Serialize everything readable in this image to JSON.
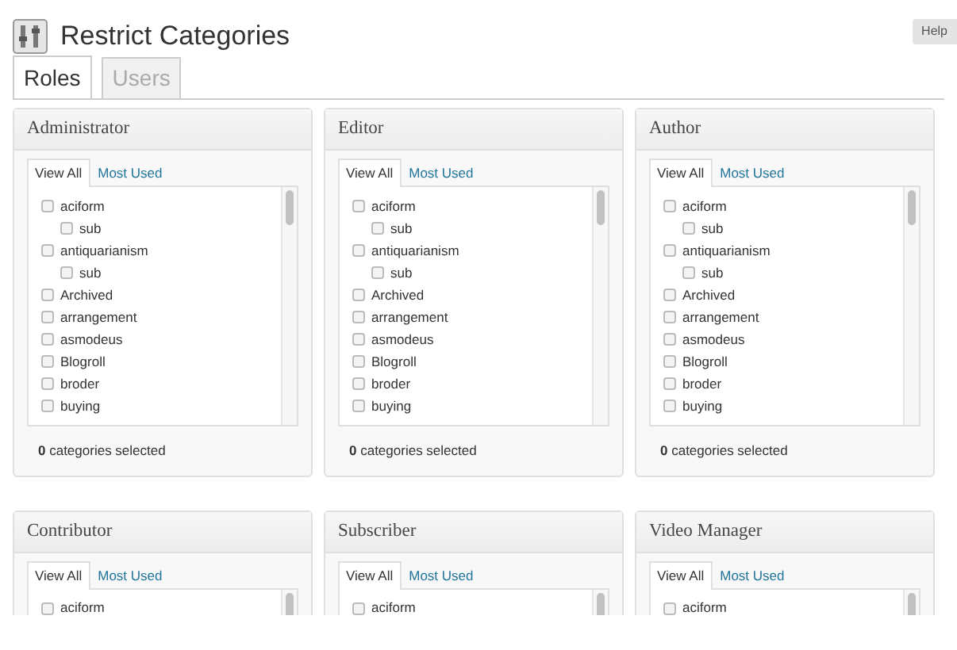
{
  "help_button": "Help",
  "page_title": "Restrict Categories",
  "tabs": [
    {
      "label": "Roles",
      "selected": true
    },
    {
      "label": "Users",
      "selected": false
    }
  ],
  "roles": [
    {
      "name": "Administrator",
      "tabs": [
        {
          "label": "View All",
          "selected": true
        },
        {
          "label": "Most Used",
          "selected": false
        }
      ],
      "categories": [
        {
          "label": "aciform",
          "checked": false,
          "children": [
            {
              "label": "sub",
              "checked": false
            }
          ]
        },
        {
          "label": "antiquarianism",
          "checked": false,
          "children": [
            {
              "label": "sub",
              "checked": false
            }
          ]
        },
        {
          "label": "Archived",
          "checked": false
        },
        {
          "label": "arrangement",
          "checked": false
        },
        {
          "label": "asmodeus",
          "checked": false
        },
        {
          "label": "Blogroll",
          "checked": false
        },
        {
          "label": "broder",
          "checked": false
        },
        {
          "label": "buying",
          "checked": false
        }
      ],
      "footer": "**0** categories selected"
    },
    {
      "name": "Editor",
      "tabs": [
        {
          "label": "View All",
          "selected": true
        },
        {
          "label": "Most Used",
          "selected": false
        }
      ],
      "categories": [
        {
          "label": "aciform",
          "checked": false,
          "children": [
            {
              "label": "sub",
              "checked": false
            }
          ]
        },
        {
          "label": "antiquarianism",
          "checked": false,
          "children": [
            {
              "label": "sub",
              "checked": false
            }
          ]
        },
        {
          "label": "Archived",
          "checked": false
        },
        {
          "label": "arrangement",
          "checked": false
        },
        {
          "label": "asmodeus",
          "checked": false
        },
        {
          "label": "Blogroll",
          "checked": false
        },
        {
          "label": "broder",
          "checked": false
        },
        {
          "label": "buying",
          "checked": false
        }
      ],
      "footer": "**0** categories selected"
    },
    {
      "name": "Author",
      "tabs": [
        {
          "label": "View All",
          "selected": true
        },
        {
          "label": "Most Used",
          "selected": false
        }
      ],
      "categories": [
        {
          "label": "aciform",
          "checked": false,
          "children": [
            {
              "label": "sub",
              "checked": false
            }
          ]
        },
        {
          "label": "antiquarianism",
          "checked": false,
          "children": [
            {
              "label": "sub",
              "checked": false
            }
          ]
        },
        {
          "label": "Archived",
          "checked": false
        },
        {
          "label": "arrangement",
          "checked": false
        },
        {
          "label": "asmodeus",
          "checked": false
        },
        {
          "label": "Blogroll",
          "checked": false
        },
        {
          "label": "broder",
          "checked": false
        },
        {
          "label": "buying",
          "checked": false
        }
      ],
      "footer": "**0** categories selected"
    },
    {
      "name": "Contributor",
      "tabs": [
        {
          "label": "View All",
          "selected": true
        },
        {
          "label": "Most Used",
          "selected": false
        }
      ],
      "categories": [
        {
          "label": "aciform",
          "checked": false
        }
      ]
    },
    {
      "name": "Subscriber",
      "tabs": [
        {
          "label": "View All",
          "selected": true
        },
        {
          "label": "Most Used",
          "selected": false
        }
      ],
      "categories": [
        {
          "label": "aciform",
          "checked": false
        }
      ]
    },
    {
      "name": "Video Manager",
      "tabs": [
        {
          "label": "View All",
          "selected": true
        },
        {
          "label": "Most Used",
          "selected": false
        }
      ],
      "categories": [
        {
          "label": "aciform",
          "checked": false
        }
      ]
    }
  ]
}
